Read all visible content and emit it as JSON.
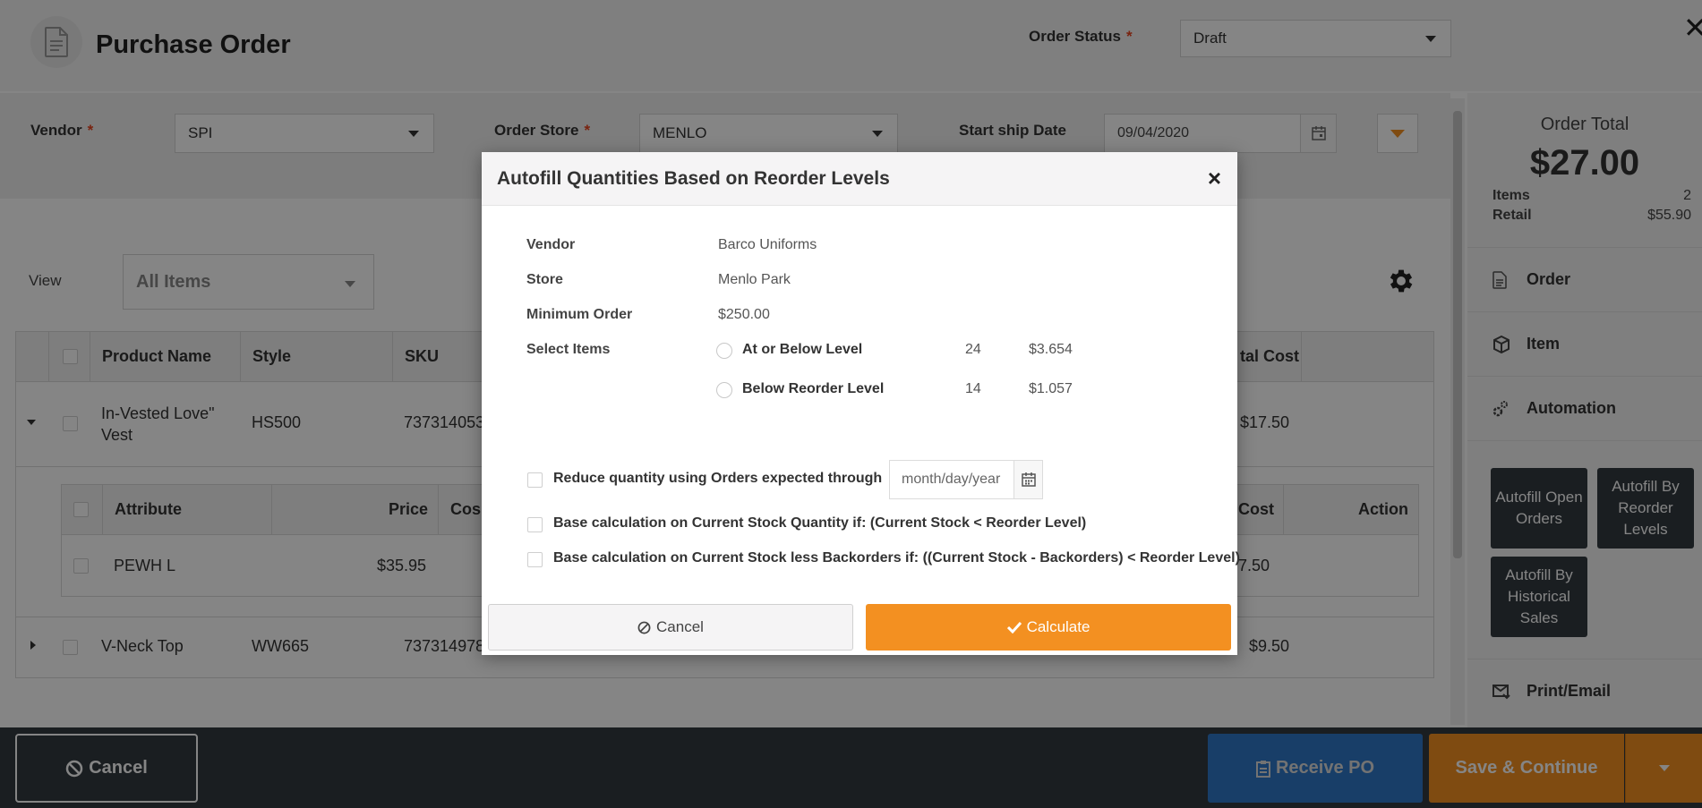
{
  "header": {
    "title": "Purchase Order",
    "order_status_label": "Order Status",
    "required_mark": "*",
    "order_status_value": "Draft",
    "close_glyph": "✕"
  },
  "filters": {
    "vendor_label": "Vendor",
    "vendor_value": "SPI",
    "store_label": "Order Store",
    "store_value": "MENLO",
    "ship_label": "Start ship Date",
    "ship_value": "09/04/2020"
  },
  "view": {
    "label": "View",
    "value": "All Items"
  },
  "grid": {
    "columns": [
      "Product Name",
      "Style",
      "SKU",
      "tal Cost"
    ],
    "rows": [
      {
        "name_line1": "In-Vested Love\"",
        "name_line2": "Vest",
        "style": "HS500",
        "sku": "737314053",
        "total": "$17.50"
      },
      {
        "name": "V-Neck Top",
        "style": "WW665",
        "sku": "737314978",
        "total": "$9.50"
      }
    ],
    "sub_columns": [
      "Attribute",
      "Price",
      "Cos",
      "Cost",
      "Action"
    ],
    "sub_rows": [
      {
        "attribute": "PEWH L",
        "price": "$35.95",
        "cost": "7.50"
      }
    ]
  },
  "sidebar": {
    "total_label": "Order Total",
    "total_value": "$27.00",
    "items_label": "Items",
    "items_value": "2",
    "retail_label": "Retail",
    "retail_value": "$55.90",
    "menu": [
      {
        "label": "Order"
      },
      {
        "label": "Item"
      },
      {
        "label": "Automation"
      },
      {
        "label": "Print/Email"
      }
    ],
    "autofill_open": "Autofill Open Orders",
    "autofill_reorder": "Autofill By Reorder Levels",
    "autofill_hist": "Autofill By Historical Sales"
  },
  "footer": {
    "cancel": "Cancel",
    "receive": "Receive PO",
    "save": "Save & Continue"
  },
  "modal": {
    "title": "Autofill Quantities Based on Reorder Levels",
    "close_glyph": "×",
    "vendor_label": "Vendor",
    "vendor_value": "Barco Uniforms",
    "store_label": "Store",
    "store_value": "Menlo Park",
    "min_label": "Minimum Order",
    "min_value": "$250.00",
    "select_label": "Select Items",
    "options": [
      {
        "label": "At or Below Level",
        "count": "24",
        "amount": "$3.654"
      },
      {
        "label": "Below Reorder Level",
        "count": "14",
        "amount": "$1.057"
      }
    ],
    "reduce_label": "Reduce quantity using Orders expected through",
    "date_placeholder": "month/day/year",
    "base_current_label": "Base calculation on Current Stock Quantity if: (Current Stock < Reorder Level)",
    "base_backorders_label": "Base calculation on Current Stock less Backorders if: ((Current Stock - Backorders) < Reorder Level)",
    "cancel_label": "Cancel",
    "calculate_label": "Calculate"
  },
  "colors": {
    "accent_orange": "#f39021",
    "dark_bar": "#323a40",
    "receive_blue": "#2e78c7",
    "required_red": "#e8431e"
  }
}
